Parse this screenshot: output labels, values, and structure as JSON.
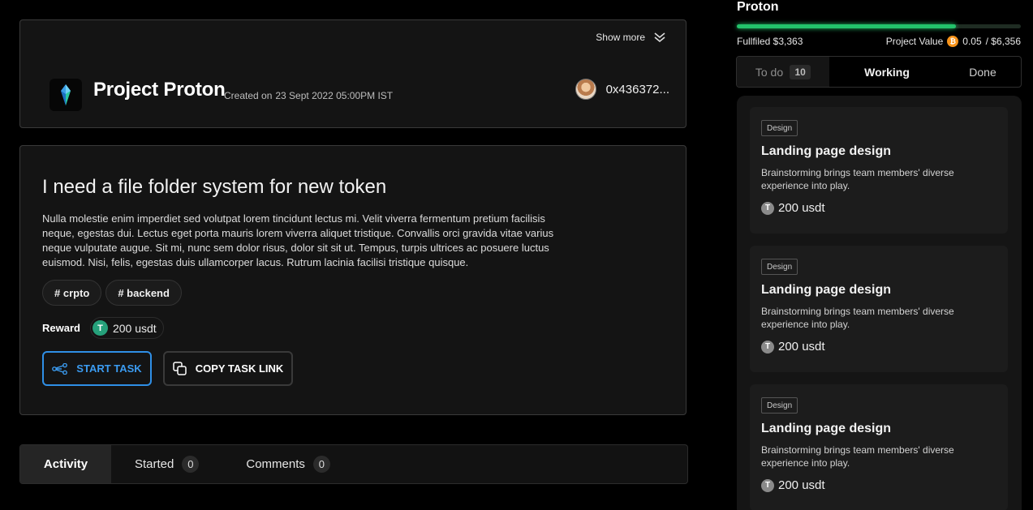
{
  "header": {
    "show_more_label": "Show more",
    "project_title": "Project Proton",
    "created_prefix": "Created on",
    "created_date": "23 Sept 2022  05:00PM IST",
    "owner_address": "0x436372..."
  },
  "task": {
    "title": "I need a file folder system for new token",
    "description": "Nulla molestie enim imperdiet sed volutpat lorem tincidunt lectus mi. Velit viverra fermentum pretium facilisis neque, egestas dui. Lectus eget porta mauris lorem viverra aliquet tristique. Convallis orci gravida vitae varius neque vulputate augue. Sit mi, nunc sem dolor risus, dolor sit sit ut. Tempus, turpis ultrices ac posuere luctus euismod. Nisi, felis, egestas duis ullamcorper lacus. Rutrum lacinia facilisi tristique quisque.",
    "tags": [
      "# crpto",
      "# backend"
    ],
    "reward_label": "Reward",
    "reward_value": "200 usdt",
    "start_label": "START TASK",
    "copy_label": "COPY TASK LINK"
  },
  "bottom_tabs": {
    "activity": "Activity",
    "started": "Started",
    "started_count": "0",
    "comments": "Comments",
    "comments_count": "0"
  },
  "panel": {
    "title": "Proton",
    "progress_fraction": 0.77,
    "fulfilled": "Fullfiled $3,363",
    "project_value_label": "Project Value",
    "project_value_btc": "0.05",
    "project_value_usd": " / $6,356",
    "tabs": {
      "todo": "To do",
      "todo_count": "10",
      "working": "Working",
      "done": "Done"
    },
    "cards": [
      {
        "tag": "Design",
        "title": "Landing page design",
        "description": "Brainstorming brings team members' diverse experience into play.",
        "reward": "200 usdt"
      },
      {
        "tag": "Design",
        "title": "Landing page design",
        "description": "Brainstorming brings team members' diverse experience into play.",
        "reward": "200 usdt"
      },
      {
        "tag": "Design",
        "title": "Landing page design",
        "description": "Brainstorming brings team members' diverse experience into play.",
        "reward": "200 usdt"
      }
    ]
  },
  "colors": {
    "accent_blue": "#2f8fe6",
    "progress_green": "#23c26b",
    "usdt_green": "#26a17b",
    "btc_orange": "#f7931a"
  }
}
